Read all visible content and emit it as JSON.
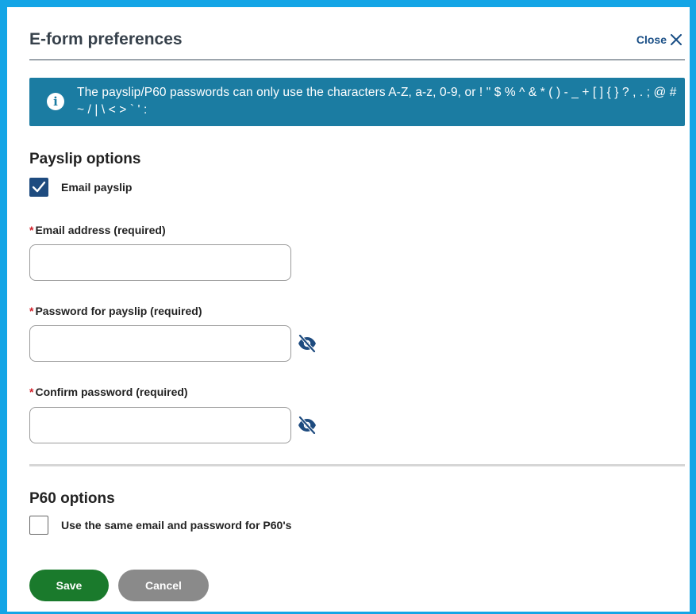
{
  "dialog": {
    "title": "E-form preferences",
    "close_label": "Close"
  },
  "alert": {
    "icon": "info-icon",
    "text": "The payslip/P60 passwords can only use the characters A-Z, a-z, 0-9, or ! \" $ % ^ & * ( ) - _ + [ ] { } ? , . ; @ # ~ / | \\ < > ` ' :"
  },
  "payslip_options": {
    "heading": "Payslip options",
    "email_payslip": {
      "label": "Email payslip",
      "checked": true
    },
    "email_address": {
      "label": "Email address (required)",
      "value": "",
      "placeholder": ""
    },
    "password": {
      "label": "Password for payslip (required)",
      "value": "",
      "placeholder": ""
    },
    "confirm_password": {
      "label": "Confirm password (required)",
      "value": "",
      "placeholder": ""
    },
    "required_marker": "*"
  },
  "p60_options": {
    "heading": "P60 options",
    "same_credentials": {
      "label": "Use the same email and password for P60's",
      "checked": false
    }
  },
  "actions": {
    "save_label": "Save",
    "cancel_label": "Cancel"
  },
  "colors": {
    "frame": "#14a5e6",
    "alert_bg": "#1b7ca2",
    "checkbox_checked": "#1e4b7f",
    "save": "#1a7a2c",
    "cancel": "#8a8a8a",
    "required": "#d0202a",
    "close_link": "#1a4f86"
  }
}
